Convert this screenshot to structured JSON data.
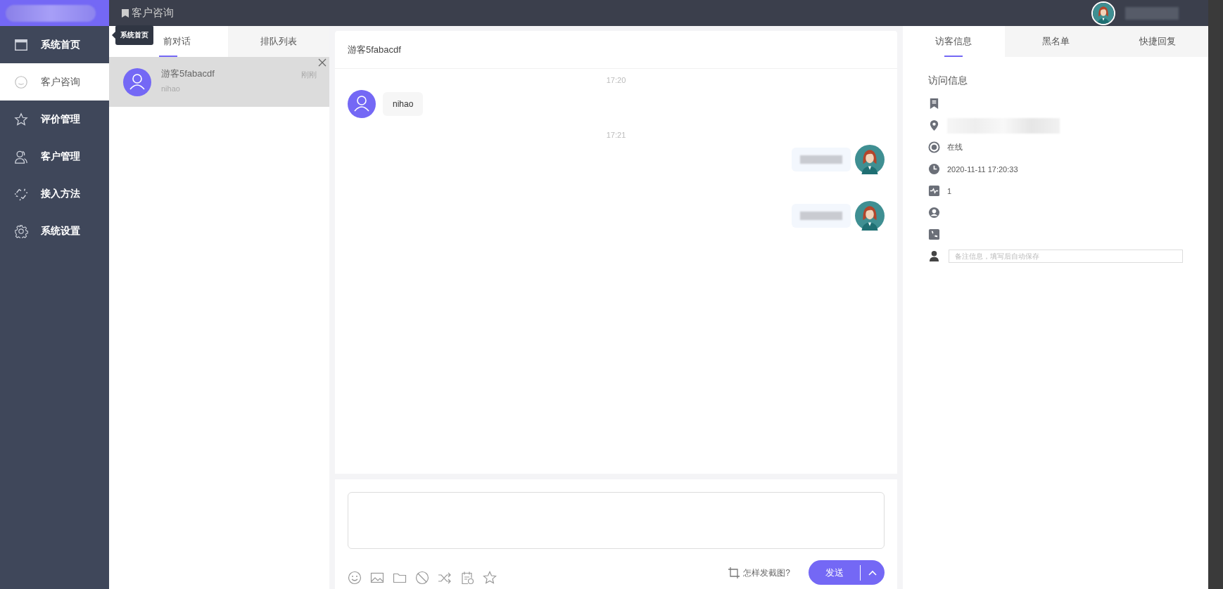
{
  "header": {
    "title": "客户咨询"
  },
  "sidebar": {
    "items": [
      {
        "label": "系统首页",
        "kind": "window",
        "selected": false
      },
      {
        "label": "客户咨询",
        "kind": "smile",
        "selected": true
      },
      {
        "label": "评价管理",
        "kind": "star",
        "selected": false
      },
      {
        "label": "客户管理",
        "kind": "users",
        "selected": false
      },
      {
        "label": "接入方法",
        "kind": "link",
        "selected": false
      },
      {
        "label": "系统设置",
        "kind": "gear",
        "selected": false
      }
    ]
  },
  "tooltip": {
    "text": "系统首页"
  },
  "conversation_tabs": [
    {
      "label": "前对话",
      "selected": true
    },
    {
      "label": "排队列表",
      "selected": false
    }
  ],
  "conversations": [
    {
      "name": "游客5fabacdf",
      "preview": "nihao",
      "time": "刚刚",
      "selected": true
    }
  ],
  "chat": {
    "title": "游客5fabacdf",
    "messages": [
      {
        "kind": "time",
        "text": "17:20"
      },
      {
        "kind": "incoming",
        "text": "nihao"
      },
      {
        "kind": "time",
        "text": "17:21"
      },
      {
        "kind": "outgoing_redacted"
      },
      {
        "kind": "outgoing_redacted"
      }
    ]
  },
  "composer": {
    "tools": [
      {
        "kind": "smile"
      },
      {
        "kind": "image"
      },
      {
        "kind": "folder"
      },
      {
        "kind": "ban"
      },
      {
        "kind": "shuffle"
      },
      {
        "kind": "calendar"
      },
      {
        "kind": "star"
      }
    ],
    "help_link": "怎样发截图?",
    "send_button": "发送"
  },
  "info_tabs": [
    {
      "label": "访客信息",
      "selected": true
    },
    {
      "label": "黑名单",
      "selected": false
    },
    {
      "label": "快捷回复",
      "selected": false
    }
  ],
  "visit_info": {
    "title": "访问信息",
    "rows": [
      {
        "kind": "bookmark"
      },
      {
        "kind": "location"
      },
      {
        "kind": "status",
        "text": "在线"
      },
      {
        "kind": "clock",
        "text": "2020-11-11 17:20:33"
      },
      {
        "kind": "activity",
        "text": "1"
      },
      {
        "kind": "user"
      },
      {
        "kind": "phone"
      }
    ],
    "note_placeholder": "备注信息，填写后自动保存"
  }
}
